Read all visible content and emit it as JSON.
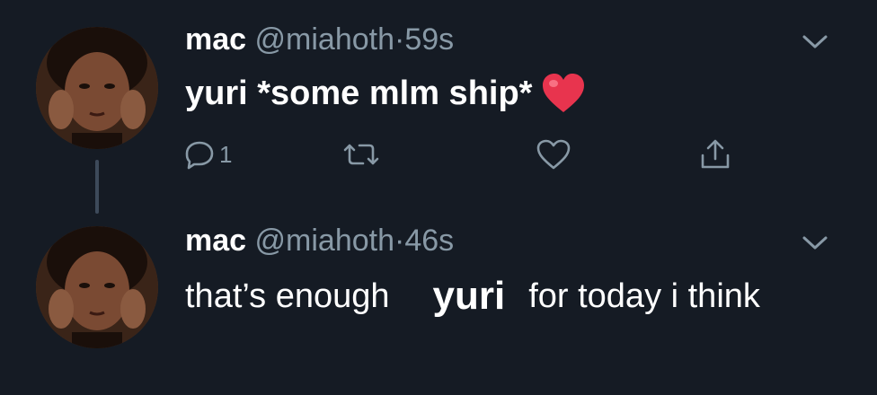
{
  "tweets": [
    {
      "name": "mac",
      "handle": "@miahoth",
      "separator": "·",
      "time": "59s",
      "text": "yuri *some mlm ship*",
      "emoji": "red-heart",
      "reply_count": "1"
    },
    {
      "name": "mac",
      "handle": "@miahoth",
      "separator": "·",
      "time": "46s",
      "text_before": "that’s enough",
      "text_overlay": "yuri",
      "text_after": "for today i think"
    }
  ],
  "colors": {
    "background": "#151b24",
    "secondary_text": "#8899a6",
    "primary_text": "#ffffff",
    "thread_line": "#3d4a5a",
    "heart_emoji": "#e8344e"
  },
  "icons": [
    "reply-icon",
    "retweet-icon",
    "like-icon",
    "share-icon",
    "chevron-down-icon",
    "heart-emoji-icon"
  ]
}
